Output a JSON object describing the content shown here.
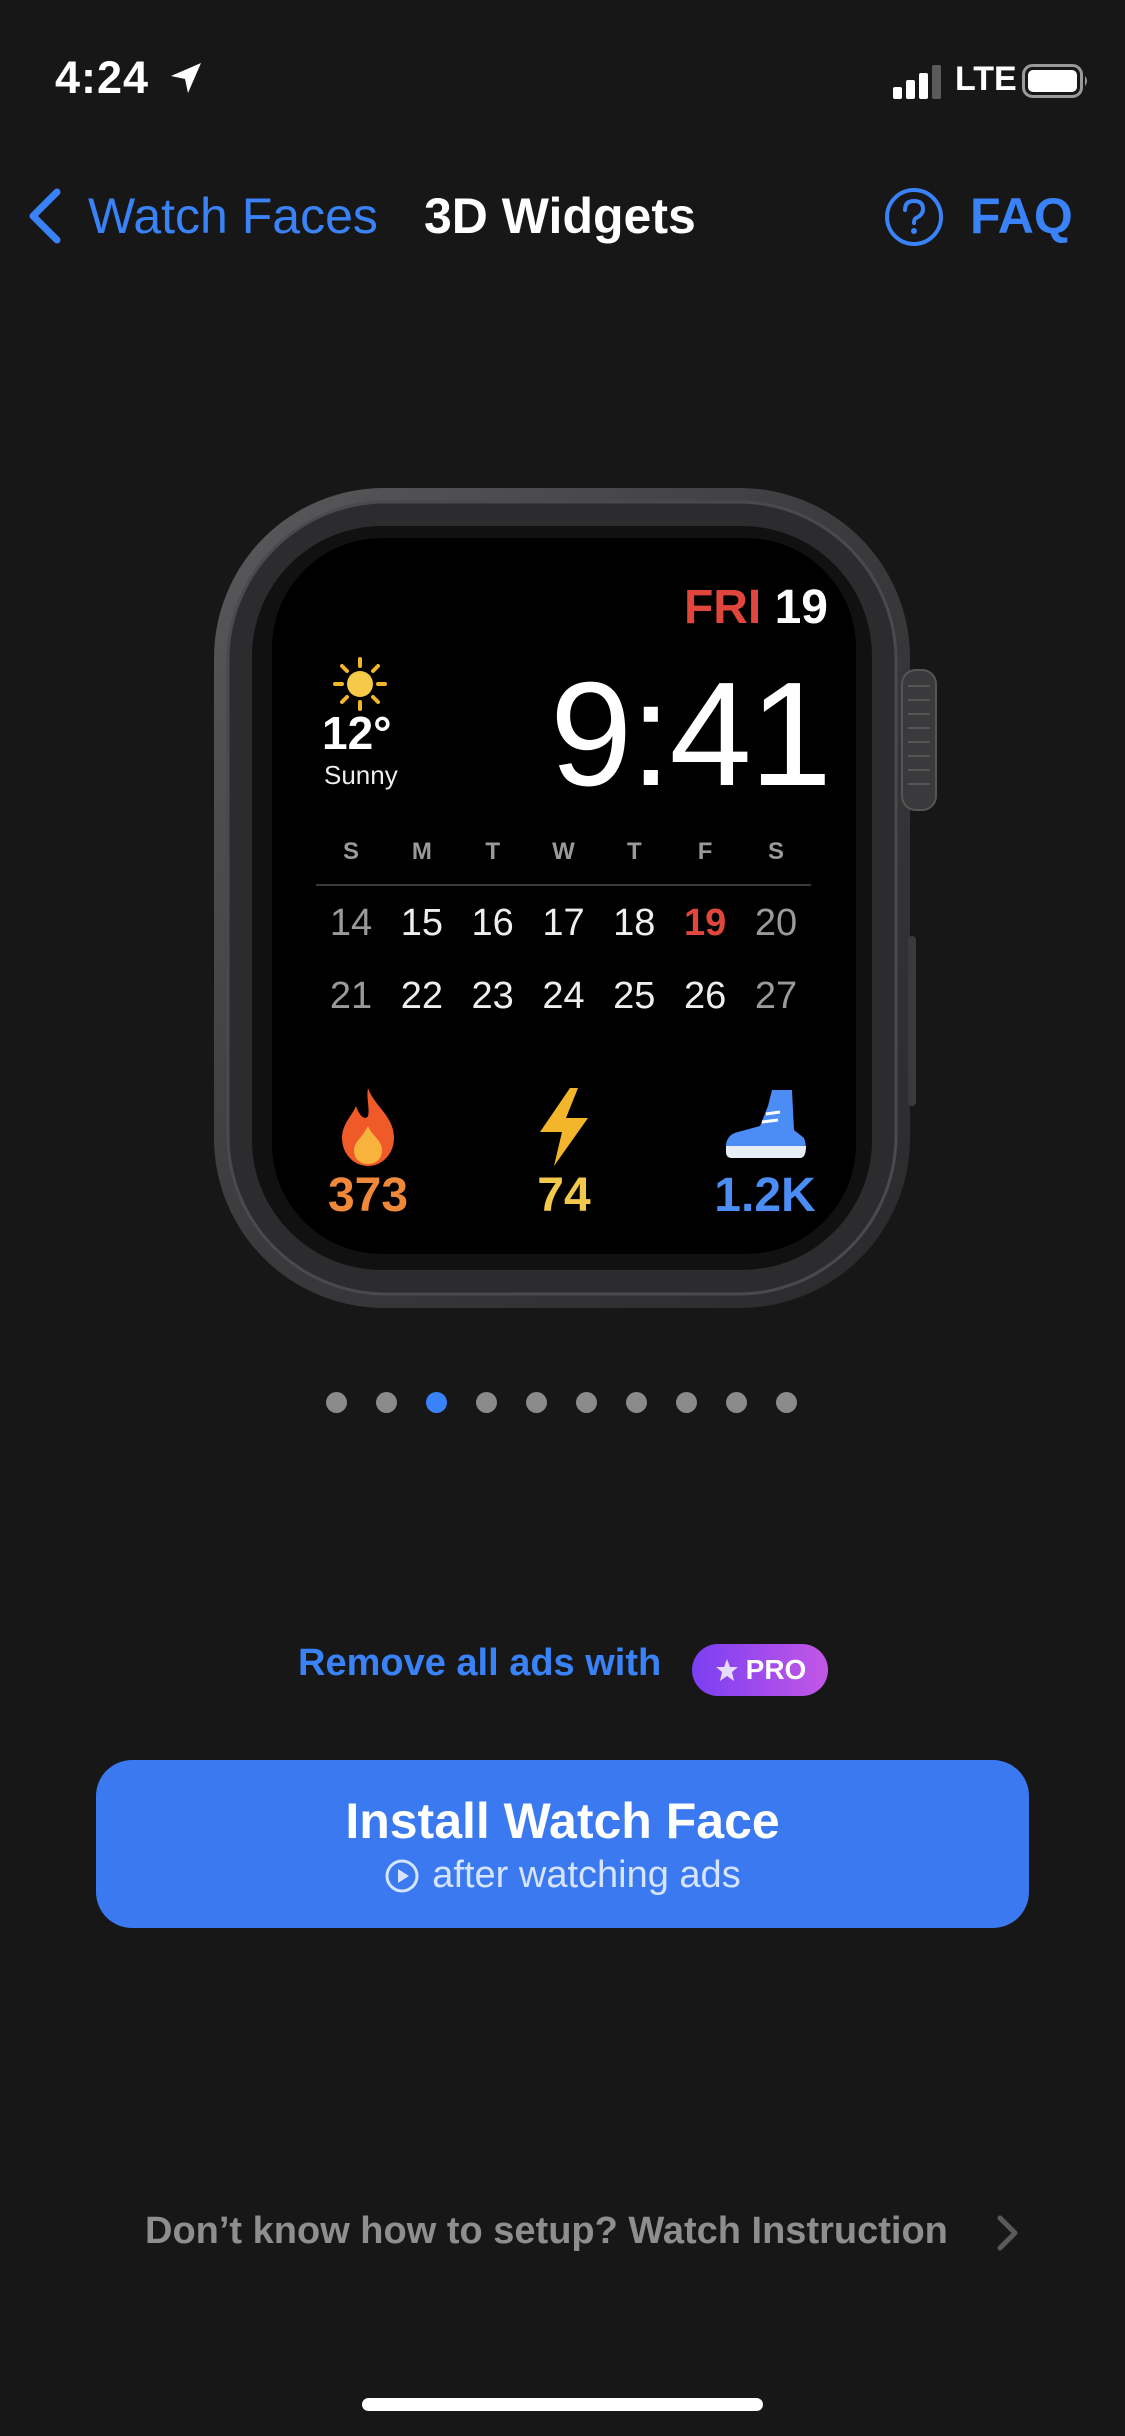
{
  "status_bar": {
    "time": "4:24",
    "network": "LTE"
  },
  "nav": {
    "back_label": "Watch Faces",
    "title": "3D Widgets",
    "faq_label": "FAQ"
  },
  "watch_face": {
    "day": "FRI",
    "date": "19",
    "time": "9:41",
    "temperature": "12°",
    "condition": "Sunny",
    "weekdays": [
      "S",
      "M",
      "T",
      "W",
      "T",
      "F",
      "S"
    ],
    "week1": [
      "14",
      "15",
      "16",
      "17",
      "18",
      "19",
      "20"
    ],
    "week2": [
      "21",
      "22",
      "23",
      "24",
      "25",
      "26",
      "27"
    ],
    "calories": "373",
    "energy": "74",
    "steps": "1.2K"
  },
  "pager": {
    "count": 10,
    "active_index": 2
  },
  "promo": {
    "text": "Remove all ads with",
    "badge": "PRO"
  },
  "install_button": {
    "title": "Install Watch Face",
    "subtitle": "after watching ads"
  },
  "help": {
    "text": "Don’t know how to setup? Watch Instruction"
  },
  "colors": {
    "accent": "#3a82f7",
    "button": "#3a79f0",
    "today": "#e0463c",
    "calories": "#f0883a",
    "energy": "#f2c94c",
    "steps": "#4c8cf5",
    "background": "#171717"
  }
}
